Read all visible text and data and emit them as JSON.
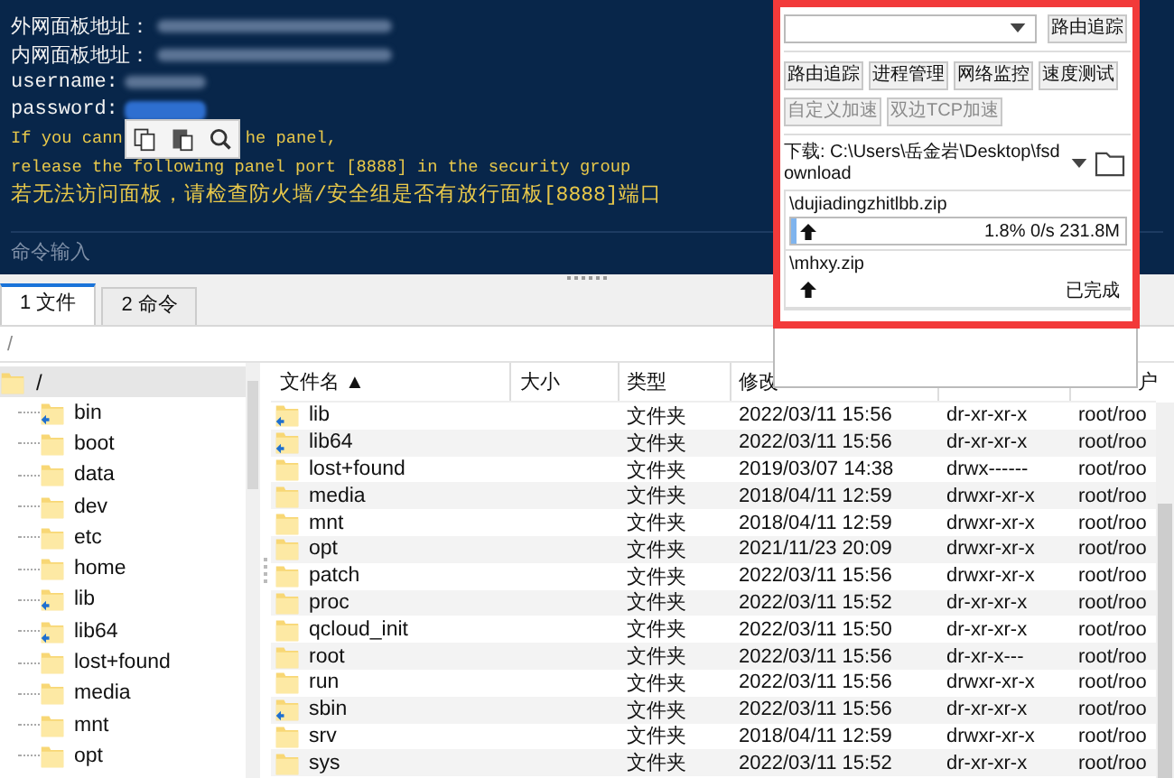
{
  "terminal": {
    "lines": [
      {
        "kind": "field",
        "text": "外网面板地址："
      },
      {
        "kind": "field",
        "text": "内网面板地址："
      },
      {
        "kind": "field",
        "text": "username:"
      },
      {
        "kind": "selected_field",
        "text": "password:"
      },
      {
        "kind": "notice",
        "text": "If you cann",
        "text_after": "he panel,"
      },
      {
        "kind": "notice",
        "text": "release the following panel port [8888] in the security group"
      },
      {
        "kind": "notice",
        "text": "若无法访问面板，请检查防火墙/安全组是否有放行面板[8888]端口"
      }
    ],
    "command_input": {
      "placeholder": "命令输入"
    }
  },
  "tabs": [
    {
      "label": "1 文件",
      "selected": true
    },
    {
      "label": "2 命令",
      "selected": false
    }
  ],
  "path": "/",
  "tree": {
    "label": "/",
    "selected": true,
    "children": [
      {
        "label": "bin",
        "kind": "link"
      },
      {
        "label": "boot",
        "kind": "folder"
      },
      {
        "label": "data",
        "kind": "folder"
      },
      {
        "label": "dev",
        "kind": "folder"
      },
      {
        "label": "etc",
        "kind": "folder"
      },
      {
        "label": "home",
        "kind": "folder"
      },
      {
        "label": "lib",
        "kind": "link"
      },
      {
        "label": "lib64",
        "kind": "link"
      },
      {
        "label": "lost+found",
        "kind": "folder"
      },
      {
        "label": "media",
        "kind": "folder"
      },
      {
        "label": "mnt",
        "kind": "folder"
      },
      {
        "label": "opt",
        "kind": "folder"
      }
    ]
  },
  "file_list": {
    "columns": [
      "文件名 ▲",
      "大小",
      "类型",
      "修改",
      "户"
    ],
    "rows": [
      {
        "name": "lib",
        "kind": "link",
        "type": "文件夹",
        "modified": "2022/03/11 15:56",
        "permissions": "dr-xr-xr-x",
        "owner": "root/roo"
      },
      {
        "name": "lib64",
        "kind": "link",
        "type": "文件夹",
        "modified": "2022/03/11 15:56",
        "permissions": "dr-xr-xr-x",
        "owner": "root/roo"
      },
      {
        "name": "lost+found",
        "kind": "folder",
        "type": "文件夹",
        "modified": "2019/03/07 14:38",
        "permissions": "drwx------",
        "owner": "root/roo"
      },
      {
        "name": "media",
        "kind": "folder",
        "type": "文件夹",
        "modified": "2018/04/11 12:59",
        "permissions": "drwxr-xr-x",
        "owner": "root/roo"
      },
      {
        "name": "mnt",
        "kind": "folder",
        "type": "文件夹",
        "modified": "2018/04/11 12:59",
        "permissions": "drwxr-xr-x",
        "owner": "root/roo"
      },
      {
        "name": "opt",
        "kind": "folder",
        "type": "文件夹",
        "modified": "2021/11/23 20:09",
        "permissions": "drwxr-xr-x",
        "owner": "root/roo"
      },
      {
        "name": "patch",
        "kind": "folder",
        "type": "文件夹",
        "modified": "2022/03/11 15:56",
        "permissions": "drwxr-xr-x",
        "owner": "root/roo"
      },
      {
        "name": "proc",
        "kind": "folder",
        "type": "文件夹",
        "modified": "2022/03/11 15:52",
        "permissions": "dr-xr-xr-x",
        "owner": "root/roo"
      },
      {
        "name": "qcloud_init",
        "kind": "folder",
        "type": "文件夹",
        "modified": "2022/03/11 15:50",
        "permissions": "dr-xr-xr-x",
        "owner": "root/roo"
      },
      {
        "name": "root",
        "kind": "folder",
        "type": "文件夹",
        "modified": "2022/03/11 15:56",
        "permissions": "dr-xr-x---",
        "owner": "root/roo"
      },
      {
        "name": "run",
        "kind": "folder",
        "type": "文件夹",
        "modified": "2022/03/11 15:56",
        "permissions": "drwxr-xr-x",
        "owner": "root/roo"
      },
      {
        "name": "sbin",
        "kind": "link",
        "type": "文件夹",
        "modified": "2022/03/11 15:56",
        "permissions": "dr-xr-xr-x",
        "owner": "root/roo"
      },
      {
        "name": "srv",
        "kind": "folder",
        "type": "文件夹",
        "modified": "2018/04/11 12:59",
        "permissions": "drwxr-xr-x",
        "owner": "root/roo"
      },
      {
        "name": "sys",
        "kind": "folder",
        "type": "文件夹",
        "modified": "2022/03/11 15:52",
        "permissions": "dr-xr-xr-x",
        "owner": "root/roo"
      }
    ]
  },
  "tools_panel": {
    "trace_button": "路由追踪",
    "tools": [
      {
        "label": "路由追踪",
        "disabled": false
      },
      {
        "label": "进程管理",
        "disabled": false
      },
      {
        "label": "网络监控",
        "disabled": false
      },
      {
        "label": "速度测试",
        "disabled": false
      },
      {
        "label": "自定义加速",
        "disabled": true
      },
      {
        "label": "双边TCP加速",
        "disabled": true
      }
    ],
    "download_path": "下载: C:\\Users\\岳金岩\\Desktop\\fsdownload",
    "transfers": [
      {
        "kind": "active",
        "name": "\\dujiadingzhitlbb.zip",
        "level": 0.018,
        "status": "1.8% 0/s 231.8M"
      },
      {
        "kind": "done",
        "name": "\\mhxy.zip",
        "status": "已完成"
      }
    ]
  }
}
